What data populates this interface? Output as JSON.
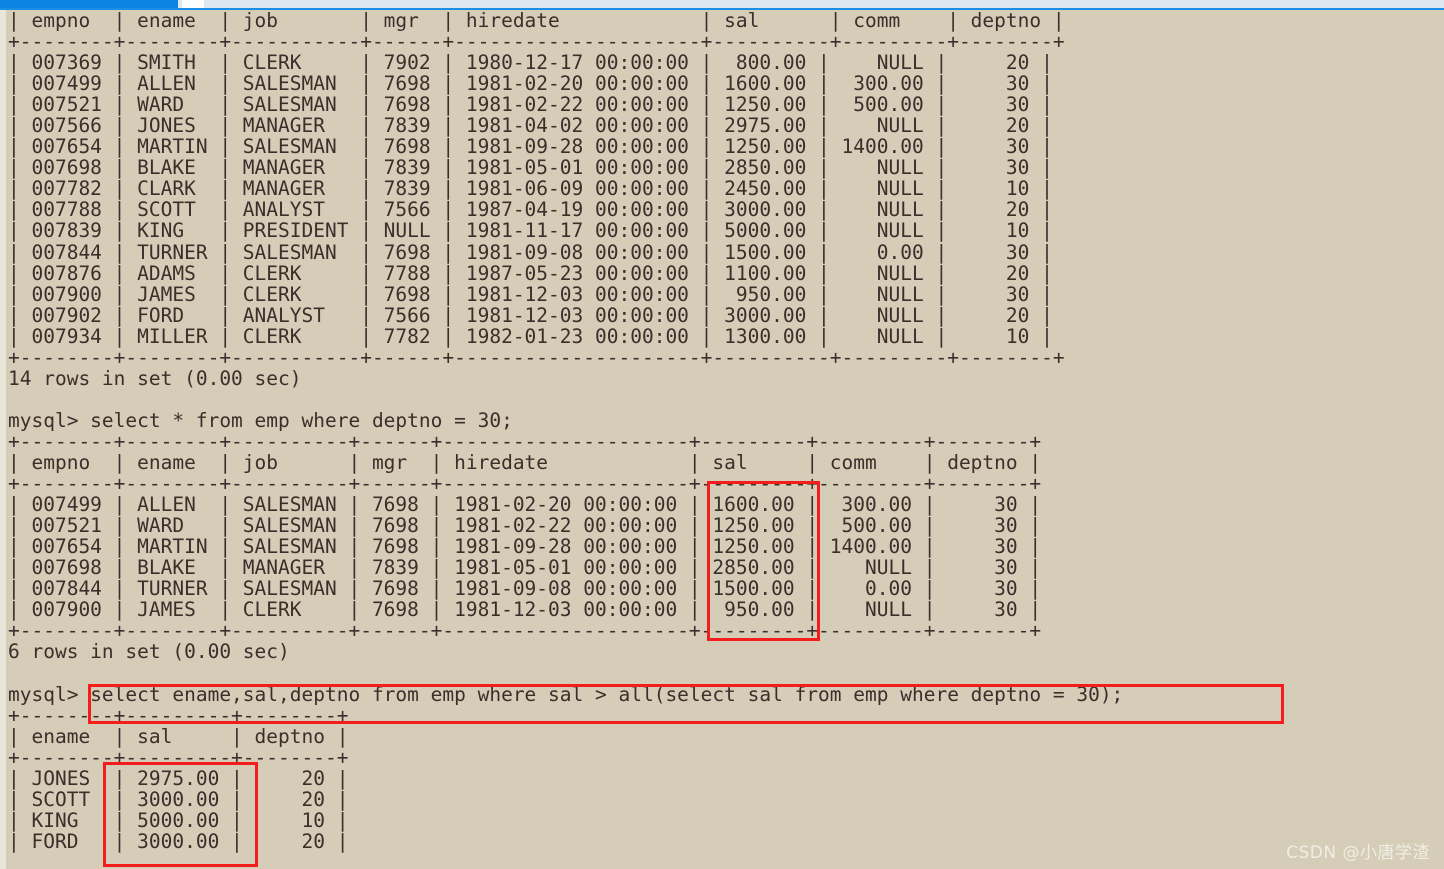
{
  "window": {
    "background_color": "#d5cdb8",
    "text_color": "#3a2f2b",
    "accent_color": "#0c84e4",
    "highlight_color": "#f51c1c",
    "scrollbar": {
      "filled_color": "#0c84e4",
      "track_color": "#dde7ef"
    }
  },
  "watermark": {
    "text": "CSDN @小唐学渣"
  },
  "console": {
    "lines": [
      "| empno  | ename  | job       | mgr  | hiredate            | sal      | comm    | deptno |",
      "+--------+--------+-----------+------+---------------------+----------+---------+--------+",
      "| 007369 | SMITH  | CLERK     | 7902 | 1980-12-17 00:00:00 |  800.00 |    NULL |     20 |",
      "| 007499 | ALLEN  | SALESMAN  | 7698 | 1981-02-20 00:00:00 | 1600.00 |  300.00 |     30 |",
      "| 007521 | WARD   | SALESMAN  | 7698 | 1981-02-22 00:00:00 | 1250.00 |  500.00 |     30 |",
      "| 007566 | JONES  | MANAGER   | 7839 | 1981-04-02 00:00:00 | 2975.00 |    NULL |     20 |",
      "| 007654 | MARTIN | SALESMAN  | 7698 | 1981-09-28 00:00:00 | 1250.00 | 1400.00 |     30 |",
      "| 007698 | BLAKE  | MANAGER   | 7839 | 1981-05-01 00:00:00 | 2850.00 |    NULL |     30 |",
      "| 007782 | CLARK  | MANAGER   | 7839 | 1981-06-09 00:00:00 | 2450.00 |    NULL |     10 |",
      "| 007788 | SCOTT  | ANALYST   | 7566 | 1987-04-19 00:00:00 | 3000.00 |    NULL |     20 |",
      "| 007839 | KING   | PRESIDENT | NULL | 1981-11-17 00:00:00 | 5000.00 |    NULL |     10 |",
      "| 007844 | TURNER | SALESMAN  | 7698 | 1981-09-08 00:00:00 | 1500.00 |    0.00 |     30 |",
      "| 007876 | ADAMS  | CLERK     | 7788 | 1987-05-23 00:00:00 | 1100.00 |    NULL |     20 |",
      "| 007900 | JAMES  | CLERK     | 7698 | 1981-12-03 00:00:00 |  950.00 |    NULL |     30 |",
      "| 007902 | FORD   | ANALYST   | 7566 | 1981-12-03 00:00:00 | 3000.00 |    NULL |     20 |",
      "| 007934 | MILLER | CLERK     | 7782 | 1982-01-23 00:00:00 | 1300.00 |    NULL |     10 |",
      "+--------+--------+-----------+------+---------------------+----------+---------+--------+",
      "14 rows in set (0.00 sec)",
      "",
      "mysql> select * from emp where deptno = 30;",
      "+--------+--------+----------+------+---------------------+---------+---------+--------+",
      "| empno  | ename  | job      | mgr  | hiredate            | sal     | comm    | deptno |",
      "+--------+--------+----------+------+---------------------+---------+---------+--------+",
      "| 007499 | ALLEN  | SALESMAN | 7698 | 1981-02-20 00:00:00 | 1600.00 |  300.00 |     30 |",
      "| 007521 | WARD   | SALESMAN | 7698 | 1981-02-22 00:00:00 | 1250.00 |  500.00 |     30 |",
      "| 007654 | MARTIN | SALESMAN | 7698 | 1981-09-28 00:00:00 | 1250.00 | 1400.00 |     30 |",
      "| 007698 | BLAKE  | MANAGER  | 7839 | 1981-05-01 00:00:00 | 2850.00 |    NULL |     30 |",
      "| 007844 | TURNER | SALESMAN | 7698 | 1981-09-08 00:00:00 | 1500.00 |    0.00 |     30 |",
      "| 007900 | JAMES  | CLERK    | 7698 | 1981-12-03 00:00:00 |  950.00 |    NULL |     30 |",
      "+--------+--------+----------+------+---------------------+---------+---------+--------+",
      "6 rows in set (0.00 sec)",
      "",
      "mysql> select ename,sal,deptno from emp where sal > all(select sal from emp where deptno = 30);",
      "+--------+---------+--------+",
      "| ename  | sal     | deptno |",
      "+--------+---------+--------+",
      "| JONES  | 2975.00 |     20 |",
      "| SCOTT  | 3000.00 |     20 |",
      "| KING   | 5000.00 |     10 |",
      "| FORD   | 3000.00 |     20 |"
    ]
  },
  "queries": {
    "query_1_prompt": "mysql> ",
    "query_1": "select * from emp where deptno = 30;",
    "query_2_prompt": "mysql> ",
    "query_2": "select ename,sal,deptno from emp where sal > all(select sal from emp where deptno = 30);",
    "result_1_status": "14 rows in set (0.00 sec)",
    "result_2_status": "6 rows in set (0.00 sec)"
  },
  "tables": {
    "emp_full": {
      "columns": [
        "empno",
        "ename",
        "job",
        "mgr",
        "hiredate",
        "sal",
        "comm",
        "deptno"
      ],
      "rows": [
        [
          "007369",
          "SMITH",
          "CLERK",
          "7902",
          "1980-12-17 00:00:00",
          "800.00",
          "NULL",
          "20"
        ],
        [
          "007499",
          "ALLEN",
          "SALESMAN",
          "7698",
          "1981-02-20 00:00:00",
          "1600.00",
          "300.00",
          "30"
        ],
        [
          "007521",
          "WARD",
          "SALESMAN",
          "7698",
          "1981-02-22 00:00:00",
          "1250.00",
          "500.00",
          "30"
        ],
        [
          "007566",
          "JONES",
          "MANAGER",
          "7839",
          "1981-04-02 00:00:00",
          "2975.00",
          "NULL",
          "20"
        ],
        [
          "007654",
          "MARTIN",
          "SALESMAN",
          "7698",
          "1981-09-28 00:00:00",
          "1250.00",
          "1400.00",
          "30"
        ],
        [
          "007698",
          "BLAKE",
          "MANAGER",
          "7839",
          "1981-05-01 00:00:00",
          "2850.00",
          "NULL",
          "30"
        ],
        [
          "007782",
          "CLARK",
          "MANAGER",
          "7839",
          "1981-06-09 00:00:00",
          "2450.00",
          "NULL",
          "10"
        ],
        [
          "007788",
          "SCOTT",
          "ANALYST",
          "7566",
          "1987-04-19 00:00:00",
          "3000.00",
          "NULL",
          "20"
        ],
        [
          "007839",
          "KING",
          "PRESIDENT",
          "NULL",
          "1981-11-17 00:00:00",
          "5000.00",
          "NULL",
          "10"
        ],
        [
          "007844",
          "TURNER",
          "SALESMAN",
          "7698",
          "1981-09-08 00:00:00",
          "1500.00",
          "0.00",
          "30"
        ],
        [
          "007876",
          "ADAMS",
          "CLERK",
          "7788",
          "1987-05-23 00:00:00",
          "1100.00",
          "NULL",
          "20"
        ],
        [
          "007900",
          "JAMES",
          "CLERK",
          "7698",
          "1981-12-03 00:00:00",
          "950.00",
          "NULL",
          "30"
        ],
        [
          "007902",
          "FORD",
          "ANALYST",
          "7566",
          "1981-12-03 00:00:00",
          "3000.00",
          "NULL",
          "20"
        ],
        [
          "007934",
          "MILLER",
          "CLERK",
          "7782",
          "1982-01-23 00:00:00",
          "1300.00",
          "NULL",
          "10"
        ]
      ],
      "row_count": 14
    },
    "emp_dept30": {
      "columns": [
        "empno",
        "ename",
        "job",
        "mgr",
        "hiredate",
        "sal",
        "comm",
        "deptno"
      ],
      "rows": [
        [
          "007499",
          "ALLEN",
          "SALESMAN",
          "7698",
          "1981-02-20 00:00:00",
          "1600.00",
          "300.00",
          "30"
        ],
        [
          "007521",
          "WARD",
          "SALESMAN",
          "7698",
          "1981-02-22 00:00:00",
          "1250.00",
          "500.00",
          "30"
        ],
        [
          "007654",
          "MARTIN",
          "SALESMAN",
          "7698",
          "1981-09-28 00:00:00",
          "1250.00",
          "1400.00",
          "30"
        ],
        [
          "007698",
          "BLAKE",
          "MANAGER",
          "7839",
          "1981-05-01 00:00:00",
          "2850.00",
          "NULL",
          "30"
        ],
        [
          "007844",
          "TURNER",
          "SALESMAN",
          "7698",
          "1981-09-08 00:00:00",
          "1500.00",
          "0.00",
          "30"
        ],
        [
          "007900",
          "JAMES",
          "CLERK",
          "7698",
          "1981-12-03 00:00:00",
          "950.00",
          "NULL",
          "30"
        ]
      ],
      "row_count": 6
    },
    "result_gt_all": {
      "columns": [
        "ename",
        "sal",
        "deptno"
      ],
      "rows": [
        [
          "JONES",
          "2975.00",
          "20"
        ],
        [
          "SCOTT",
          "3000.00",
          "20"
        ],
        [
          "KING",
          "5000.00",
          "10"
        ],
        [
          "FORD",
          "3000.00",
          "20"
        ]
      ]
    }
  },
  "annotations": {
    "box_sal_column_label": "sal column of deptno=30 result",
    "box_query_label": "subquery with > all",
    "box_result_sal_label": "sal values greater than all"
  }
}
